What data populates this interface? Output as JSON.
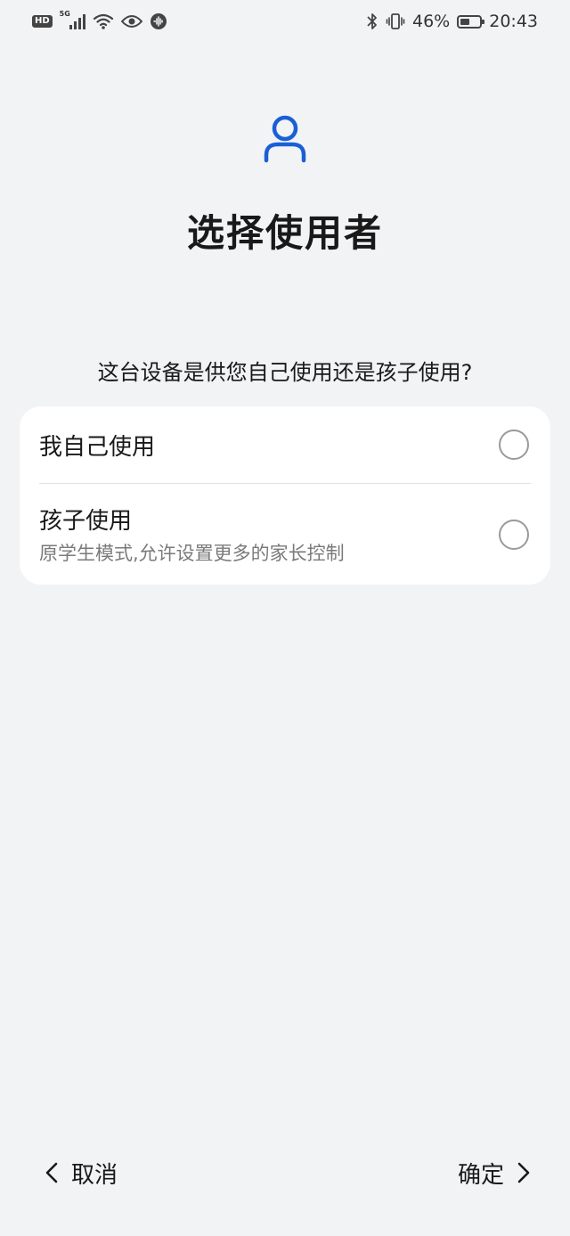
{
  "status_bar": {
    "hd": "HD",
    "network": "5G",
    "battery_percent": "46%",
    "battery_level": 0.46,
    "time": "20:43",
    "icons": [
      "hd-icon",
      "signal-icon",
      "wifi-icon",
      "eye-icon",
      "voice-icon",
      "bluetooth-icon",
      "vibrate-icon",
      "battery-icon"
    ]
  },
  "header": {
    "icon": "person-icon",
    "title": "选择使用者",
    "accent_color": "#1a5fd6"
  },
  "question": "这台设备是供您自己使用还是孩子使用?",
  "options": [
    {
      "label": "我自己使用",
      "description": "",
      "selected": false
    },
    {
      "label": "孩子使用",
      "description": "原学生模式,允许设置更多的家长控制",
      "selected": false
    }
  ],
  "footer": {
    "cancel_label": "取消",
    "confirm_label": "确定"
  }
}
